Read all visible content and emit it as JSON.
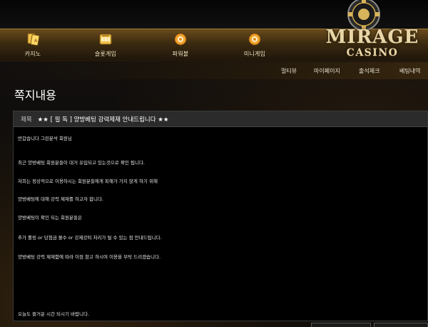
{
  "nav": {
    "items": [
      {
        "label": "카지노",
        "icon": "cards-icon"
      },
      {
        "label": "슬롯게임",
        "icon": "slot-machine-icon"
      },
      {
        "label": "파워볼",
        "icon": "powerball-icon"
      },
      {
        "label": "미니게임",
        "icon": "minigame-icon"
      }
    ]
  },
  "logo": {
    "title": "MIRAGE",
    "subtitle": "CASINO"
  },
  "subnav": {
    "items": [
      "멀티뷰",
      "마이페이지",
      "출석체크",
      "베팅내역"
    ]
  },
  "page": {
    "title": "쪽지내용"
  },
  "message": {
    "subject_label": "제목",
    "subject": "★★ [ 필 독 ] 양방베팅 강력제재 안내드립니다 ★★",
    "lines": [
      "반갑습니다 그린분석 회원님",
      "최근 양방베팅 회원분들이 대거 유입되고 있는것으로 확인 됩니다.",
      "저희는 정상적으로 이용하시는 회원분들에게 피해가 가지 않게 하기 위해",
      "양방베팅에 대해 강력 제재를 하고자 합니다.",
      "양방베팅이 확인 되는 회원분들은",
      "추가 롤링 or 당첨금 몰수 or 강제강퇴 처리가 될 수 있는 점 안내드립니다.",
      "양방베팅 강력 제재함에 따라 이점 참고 하시여 이용을 부탁 드리겠습니다.",
      "오늘도 즐거운 시간 되시기 바랍니다."
    ]
  },
  "colors": {
    "gold": "#c9a24a",
    "panel": "#000000",
    "subject_bg": "#2b2b2b"
  }
}
